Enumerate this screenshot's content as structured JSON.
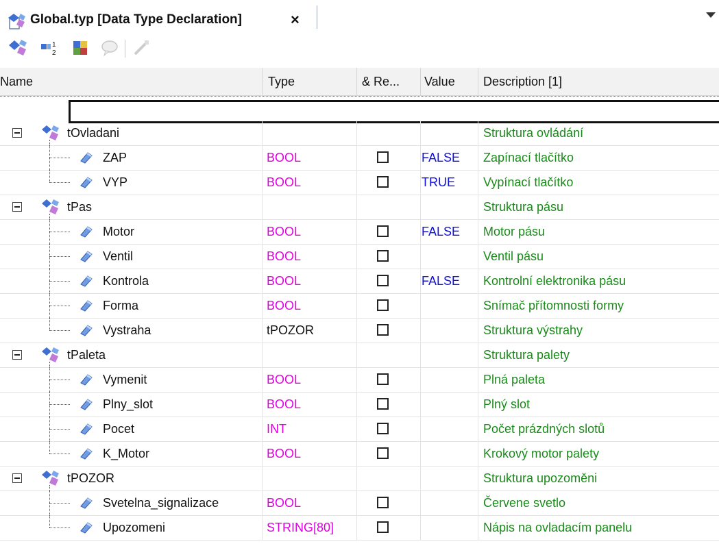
{
  "tab": {
    "title": "Global.typ [Data Type Declaration]",
    "close": "×"
  },
  "toolbar": {
    "buttons": [
      "add-type-icon",
      "add-member-icon",
      "add-struct-icon",
      "comment-icon",
      "edit-icon"
    ]
  },
  "columns": {
    "name": "Name",
    "type": "Type",
    "reference": "& Re...",
    "value": "Value",
    "description": "Description [1]"
  },
  "rows": [
    {
      "kind": "group",
      "name": "tOvladani",
      "description": "Struktura ovládání"
    },
    {
      "kind": "member",
      "name": "ZAP",
      "type": "BOOL",
      "value": "FALSE",
      "description": "Zapínací tlačítko"
    },
    {
      "kind": "member",
      "name": "VYP",
      "type": "BOOL",
      "value": "TRUE",
      "description": "Vypínací tlačítko",
      "last": true
    },
    {
      "kind": "group",
      "name": "tPas",
      "description": "Struktura pásu"
    },
    {
      "kind": "member",
      "name": "Motor",
      "type": "BOOL",
      "value": "FALSE",
      "description": "Motor pásu"
    },
    {
      "kind": "member",
      "name": "Ventil",
      "type": "BOOL",
      "value": "",
      "description": "Ventil pásu"
    },
    {
      "kind": "member",
      "name": "Kontrola",
      "type": "BOOL",
      "value": "FALSE",
      "description": "Kontrolní elektronika pásu"
    },
    {
      "kind": "member",
      "name": "Forma",
      "type": "BOOL",
      "value": "",
      "description": "Snímač přítomnosti formy"
    },
    {
      "kind": "member",
      "name": "Vystraha",
      "type": "tPOZOR",
      "value": "",
      "description": "Struktura výstrahy",
      "last": true,
      "plainType": true
    },
    {
      "kind": "group",
      "name": "tPaleta",
      "description": "Struktura palety"
    },
    {
      "kind": "member",
      "name": "Vymenit",
      "type": "BOOL",
      "value": "",
      "description": "Plná paleta"
    },
    {
      "kind": "member",
      "name": "Plny_slot",
      "type": "BOOL",
      "value": "",
      "description": "Plný slot"
    },
    {
      "kind": "member",
      "name": "Pocet",
      "type": "INT",
      "value": "",
      "description": "Počet prázdných slotů"
    },
    {
      "kind": "member",
      "name": "K_Motor",
      "type": "BOOL",
      "value": "",
      "description": "Krokový motor palety",
      "last": true
    },
    {
      "kind": "group",
      "name": "tPOZOR",
      "description": "Struktura upozoměni"
    },
    {
      "kind": "member",
      "name": "Svetelna_signalizace",
      "type": "BOOL",
      "value": "",
      "description": "Červene svetlo"
    },
    {
      "kind": "member",
      "name": "Upozomeni",
      "type": "STRING[80]",
      "value": "",
      "description": "Nápis na ovladacím panelu",
      "last": true
    }
  ],
  "colors": {
    "type": "#e000e0",
    "value": "#1010e0",
    "description": "#1a8a1a"
  }
}
